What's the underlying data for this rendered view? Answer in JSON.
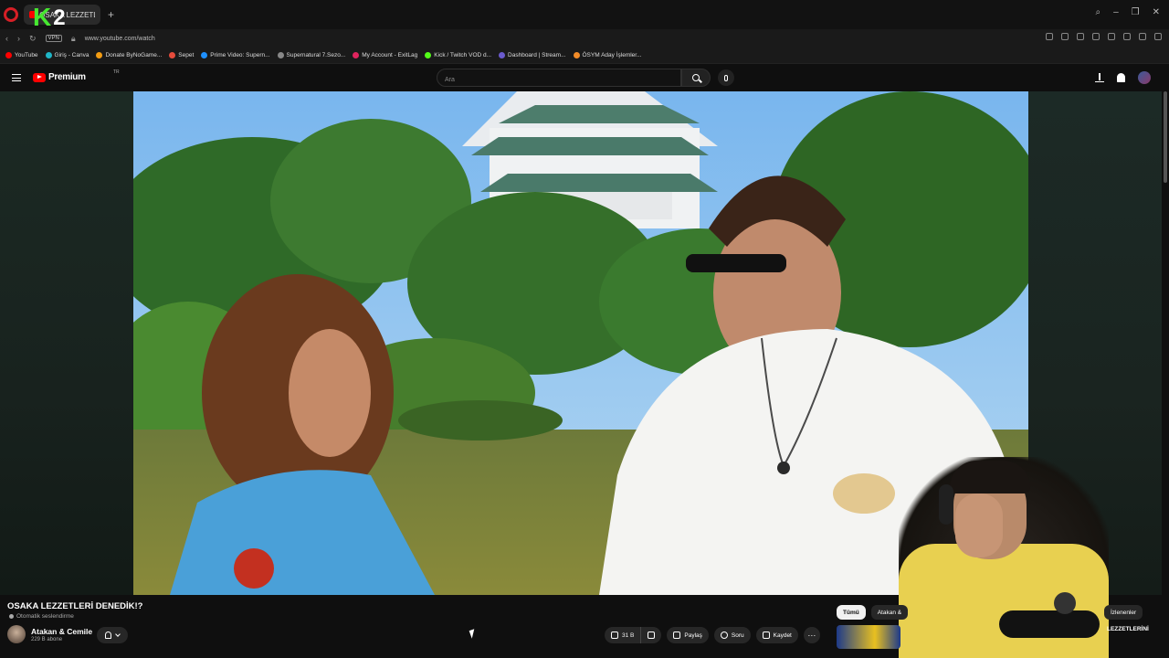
{
  "browser": {
    "tab_title": "OSAKA LEZZETLERİ D",
    "overlay_k": "K",
    "overlay_2": "2",
    "url": "www.youtube.com/watch",
    "vpn_label": "VPN",
    "bookmarks": [
      {
        "label": "YouTube",
        "color": "#ff0000"
      },
      {
        "label": "Giriş - Canva",
        "color": "#1fb5c6"
      },
      {
        "label": "Donate ByNoGame...",
        "color": "#f39c12"
      },
      {
        "label": "Sepet",
        "color": "#e74c3c"
      },
      {
        "label": "Prime Video: Supern...",
        "color": "#1e90ff"
      },
      {
        "label": "Supernatural 7.Sezo...",
        "color": "#888888"
      },
      {
        "label": "My Account - ExitLag",
        "color": "#e0245e"
      },
      {
        "label": "Kick / Twitch VOD d...",
        "color": "#53fc18"
      },
      {
        "label": "Dashboard | Stream...",
        "color": "#6a5acd"
      },
      {
        "label": "ÖSYM Aday İşlemler...",
        "color": "#f28c28"
      }
    ]
  },
  "youtube": {
    "logo_text": "Premium",
    "logo_region": "TR",
    "search_placeholder": "Ara"
  },
  "video": {
    "title": "OSAKA LEZZETLERİ DENEDİK!?",
    "auto_dub": "Otomatik seslendirme",
    "channel_name": "Atakan & Cemile",
    "subscribers": "229 B abone",
    "likes": "31 B",
    "share_label": "Paylaş",
    "ask_label": "Soru",
    "save_label": "Kaydet"
  },
  "sidebar": {
    "chips": [
      "Tümü",
      "Atakan &",
      "İzlenenler"
    ],
    "related_text": "LEZZETLERİNİ"
  }
}
